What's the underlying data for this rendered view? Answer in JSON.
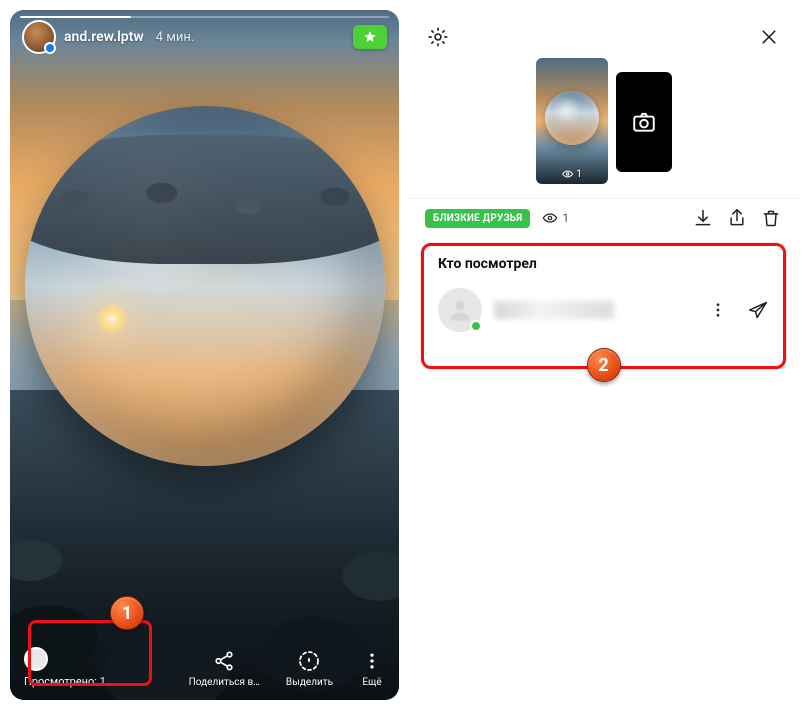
{
  "left": {
    "username": "and.rew.lptw",
    "timestamp": "4 мин.",
    "view_count_label": "Просмотрено: 1",
    "actions": {
      "share": "Поделиться в…",
      "highlight": "Выделить",
      "more": "Ещё"
    }
  },
  "right": {
    "close_friends_badge": "БЛИЗКИЕ ДРУЗЬЯ",
    "thumb_view_count": "1",
    "viewers_title": "Кто посмотрел",
    "viewer_count": "1",
    "viewers": [
      {
        "name_hidden": true,
        "online": true
      }
    ]
  },
  "annotations": {
    "badge1": "1",
    "badge2": "2"
  },
  "colors": {
    "accent_green": "#37c24a",
    "highlight_red": "#e11"
  }
}
